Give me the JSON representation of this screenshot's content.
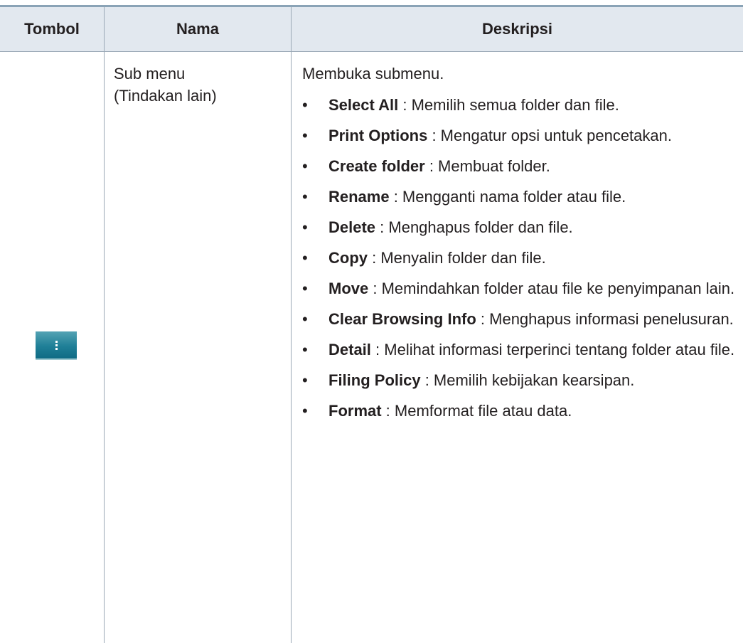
{
  "header": {
    "col1": "Tombol",
    "col2": "Nama",
    "col3": "Deskripsi"
  },
  "row": {
    "button_icon": "more-vertical-icon",
    "name_line1": "Sub menu",
    "name_line2": "(Tindakan lain)",
    "intro": "Membuka submenu.",
    "bullet_char": "•",
    "items": [
      {
        "term": "Select All",
        "desc": " : Memilih semua folder dan file."
      },
      {
        "term": "Print Options",
        "desc": " : Mengatur opsi untuk pencetakan."
      },
      {
        "term": "Create folder",
        "desc": " : Membuat folder."
      },
      {
        "term": "Rename",
        "desc": " : Mengganti nama folder atau file."
      },
      {
        "term": "Delete",
        "desc": " : Menghapus folder dan file."
      },
      {
        "term": "Copy",
        "desc": " : Menyalin folder dan file."
      },
      {
        "term": "Move",
        "desc": " : Memindahkan folder atau file ke penyimpanan lain."
      },
      {
        "term": "Clear Browsing Info",
        "desc": " : Menghapus informasi penelusuran."
      },
      {
        "term": "Detail",
        "desc": " : Melihat informasi terperinci tentang folder atau file."
      },
      {
        "term": "Filing Policy",
        "desc": " : Memilih kebijakan kearsipan."
      },
      {
        "term": "Format",
        "desc": " : Memformat file atau data."
      }
    ]
  },
  "colors": {
    "header_bg": "#e2e8ef",
    "top_rule": "#8aa3b6",
    "grid_line": "#9aa8b5",
    "icon_teal": "#1f7f97"
  }
}
